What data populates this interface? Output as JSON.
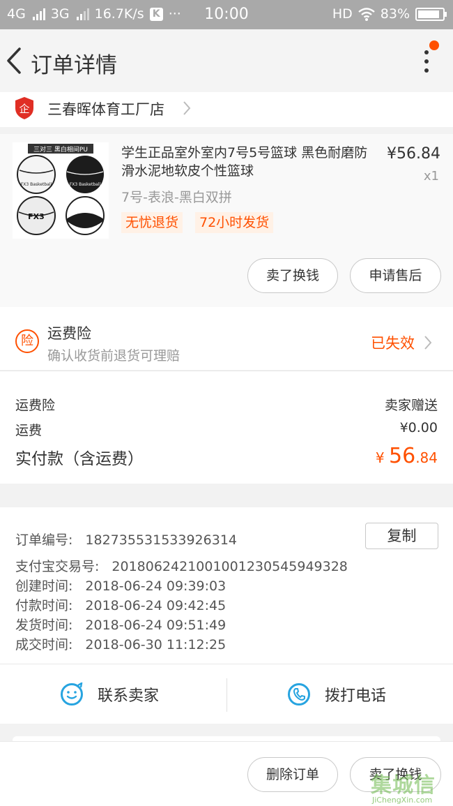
{
  "status_bar": {
    "net1": "4G",
    "net2": "3G",
    "speed": "16.7K/s",
    "app_badge": "K",
    "dots": "···",
    "time": "10:00",
    "hd": "HD",
    "battery": "83%"
  },
  "header": {
    "title": "订单详情"
  },
  "store": {
    "name": "三春晖体育工厂店"
  },
  "product": {
    "title": "学生正品室外室内7号5号篮球 黑色耐磨防滑水泥地软皮个性篮球",
    "price": "¥56.84",
    "qty": "x1",
    "spec": "7号-表浪-黑白双拼",
    "tags": [
      "无忧退货",
      "72小时发货"
    ],
    "image_caption": "三对三 黑白相间PU",
    "ball_label_1": "FX3 Basketball",
    "ball_label_2": "FX3 Basketball",
    "ball_label_3": "FX3",
    "actions": {
      "sell": "卖了换钱",
      "after_sale": "申请售后"
    }
  },
  "insurance": {
    "icon_char": "险",
    "title": "运费险",
    "subtitle": "确认收货前退货可理赔",
    "status": "已失效"
  },
  "fees": {
    "rows": [
      {
        "label": "运费险",
        "value": "卖家赠送"
      },
      {
        "label": "运费",
        "value": "¥0.00"
      }
    ],
    "paid_label": "实付款（含运费）",
    "paid_symbol": "¥",
    "paid_int": "56",
    "paid_dec": ".84"
  },
  "order_info": {
    "copy_label": "复制",
    "rows": [
      {
        "label": "订单编号:",
        "value": "182735531533926314"
      },
      {
        "label": "支付宝交易号:",
        "value": "2018062421001001230545949328"
      },
      {
        "label": "创建时间:",
        "value": "2018-06-24 09:39:03"
      },
      {
        "label": "付款时间:",
        "value": "2018-06-24 09:42:45"
      },
      {
        "label": "发货时间:",
        "value": "2018-06-24 09:51:49"
      },
      {
        "label": "成交时间:",
        "value": "2018-06-30 11:12:25"
      }
    ]
  },
  "contact": {
    "seller": "联系卖家",
    "phone": "拨打电话"
  },
  "bottom": {
    "delete": "删除订单",
    "sell": "卖了换钱"
  },
  "watermark": {
    "main": "集城信",
    "sub": "JiChengXin.com"
  },
  "colors": {
    "accent": "#ff5000",
    "icon_blue": "#27a4e0",
    "status_bar": "#a9a9a9"
  }
}
